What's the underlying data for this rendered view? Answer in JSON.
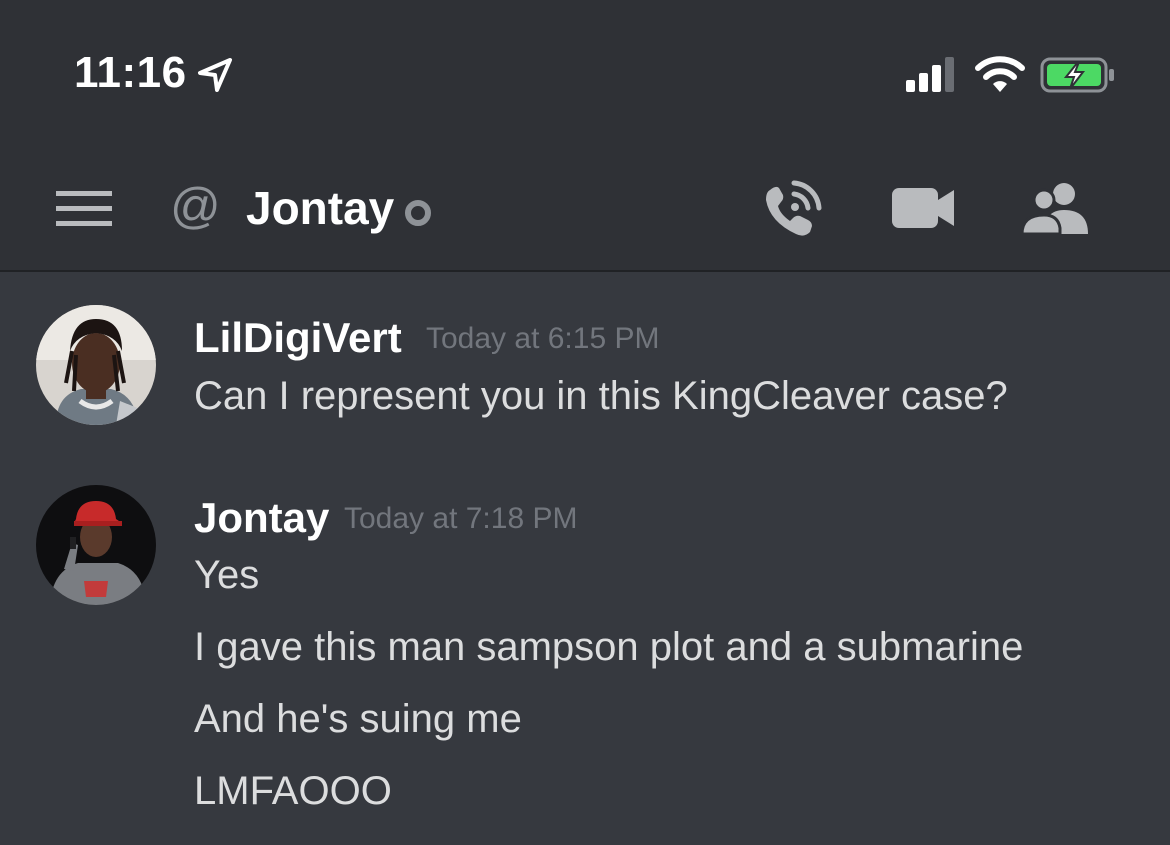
{
  "status_bar": {
    "time": "11:16",
    "icons": [
      "location-arrow-icon",
      "cellular-signal-icon",
      "wifi-icon",
      "battery-charging-icon"
    ],
    "battery_color": "#4cd964"
  },
  "header": {
    "prefix": "@",
    "channel_name": "Jontay",
    "icons": [
      "menu-icon",
      "at-icon",
      "status-dot-icon",
      "voice-call-icon",
      "video-call-icon",
      "members-icon"
    ]
  },
  "messages": [
    {
      "author": "LilDigiVert",
      "timestamp": "Today at 6:15 PM",
      "lines": [
        "Can I represent you in this KingCleaver case?"
      ]
    },
    {
      "author": "Jontay",
      "timestamp": "Today at 7:18 PM",
      "lines": [
        "Yes",
        "I gave this man sampson plot and a submarine",
        "And he's suing me",
        "LMFAOOO"
      ]
    }
  ],
  "colors": {
    "background": "#36393f",
    "header_background": "#2f3136",
    "text_primary": "#ffffff",
    "text_message": "#dcddde",
    "text_muted": "#72767d",
    "icon_muted": "#8e9297"
  }
}
